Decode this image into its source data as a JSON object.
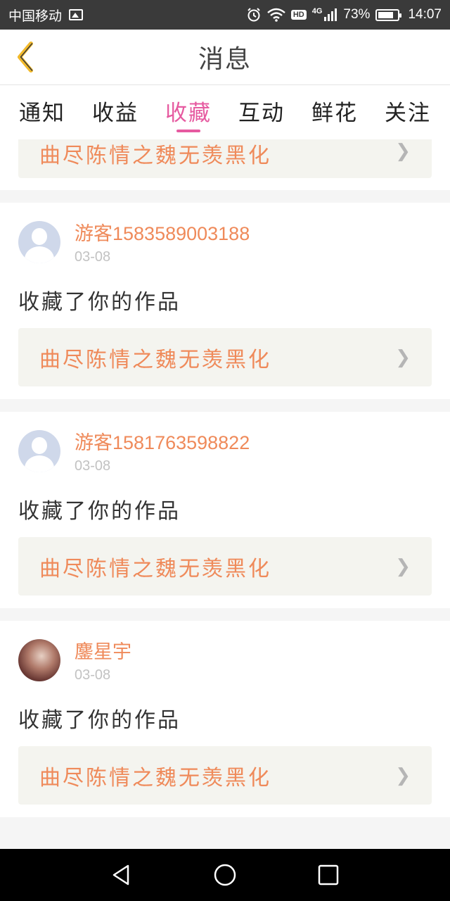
{
  "status_bar": {
    "carrier": "中国移动",
    "network": "4G",
    "hd": "HD",
    "battery": "73%",
    "time": "14:07"
  },
  "header": {
    "title": "消息"
  },
  "tabs": [
    {
      "label": "通知"
    },
    {
      "label": "收益"
    },
    {
      "label": "收藏",
      "active": true
    },
    {
      "label": "互动"
    },
    {
      "label": "鲜花"
    },
    {
      "label": "关注"
    }
  ],
  "partial_card": {
    "work_title": "曲尽陈情之魏无羡黑化"
  },
  "items": [
    {
      "username": "游客1583589003188",
      "date": "03-08",
      "action": "收藏了你的作品",
      "work_title": "曲尽陈情之魏无羡黑化"
    },
    {
      "username": "游客1581763598822",
      "date": "03-08",
      "action": "收藏了你的作品",
      "work_title": "曲尽陈情之魏无羡黑化"
    },
    {
      "username": "鏖星宇",
      "date": "03-08",
      "action": "收藏了你的作品",
      "work_title": "曲尽陈情之魏无羡黑化"
    }
  ],
  "colors": {
    "accent": "#e65aa0",
    "username": "#ef8a5a",
    "work_bg": "#f4f4ef"
  }
}
